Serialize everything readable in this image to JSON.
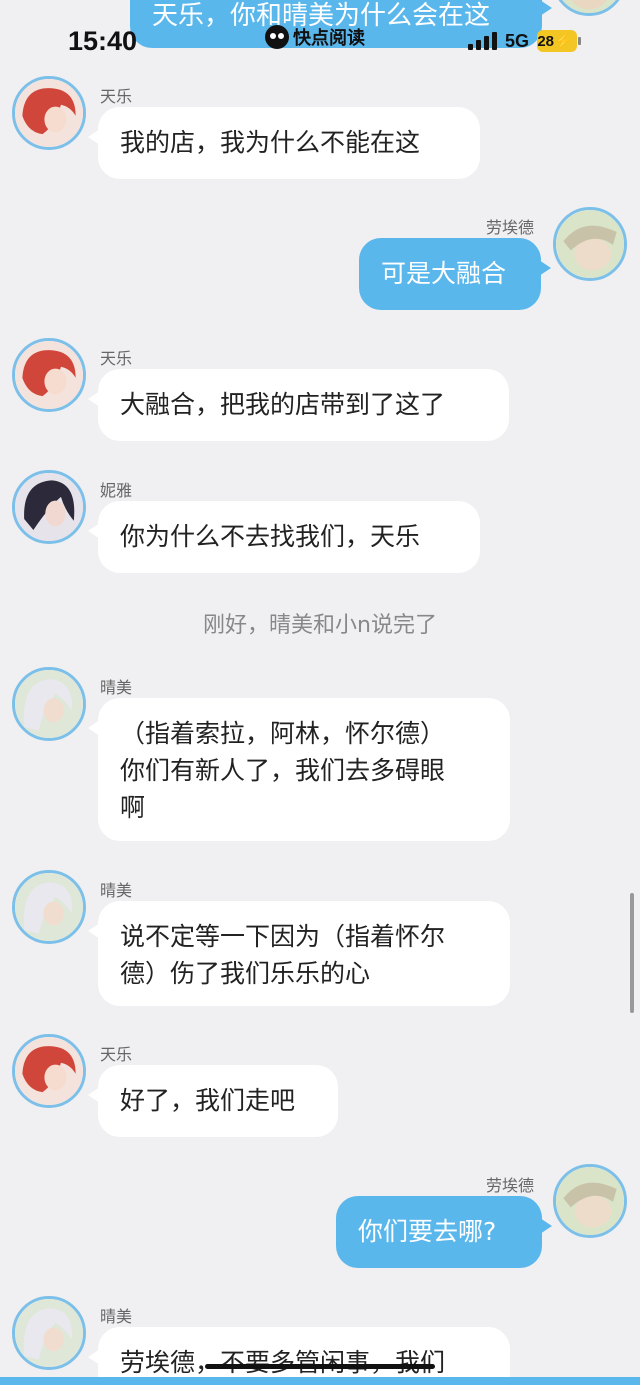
{
  "status_bar": {
    "time": "15:40",
    "app_name": "快点阅读",
    "network": "5G",
    "battery": "28"
  },
  "colors": {
    "background": "#f0f0f2",
    "right_bubble": "#5ab7ec",
    "left_bubble": "#ffffff",
    "avatar_ring": "#7cc0ea"
  },
  "messages": [
    {
      "side": "right",
      "text": "天乐，你和晴美为什么会在这"
    },
    {
      "side": "left",
      "sender": "天乐",
      "avatar": "tianle",
      "text": "我的店，我为什么不能在这"
    },
    {
      "side": "right",
      "sender": "劳埃德",
      "avatar": "lloyd",
      "text": "可是大融合"
    },
    {
      "side": "left",
      "sender": "天乐",
      "avatar": "tianle",
      "text": "大融合，把我的店带到了这了"
    },
    {
      "side": "left",
      "sender": "妮雅",
      "avatar": "niya",
      "text": "你为什么不去找我们，天乐"
    },
    {
      "side": "narration",
      "text": "刚好，晴美和小n说完了"
    },
    {
      "side": "left",
      "sender": "晴美",
      "avatar": "qingmei",
      "text": "（指着索拉，阿林，怀尔德）\n你们有新人了，我们去多碍眼\n啊"
    },
    {
      "side": "left",
      "sender": "晴美",
      "avatar": "qingmei",
      "text": "说不定等一下因为（指着怀尔\n德）伤了我们乐乐的心"
    },
    {
      "side": "left",
      "sender": "天乐",
      "avatar": "tianle",
      "text": "好了，我们走吧"
    },
    {
      "side": "right",
      "sender": "劳埃德",
      "avatar": "lloyd",
      "text": "你们要去哪?"
    },
    {
      "side": "left",
      "sender": "晴美",
      "avatar": "qingmei",
      "text": "劳埃德，不要多管闲事，我们"
    }
  ]
}
